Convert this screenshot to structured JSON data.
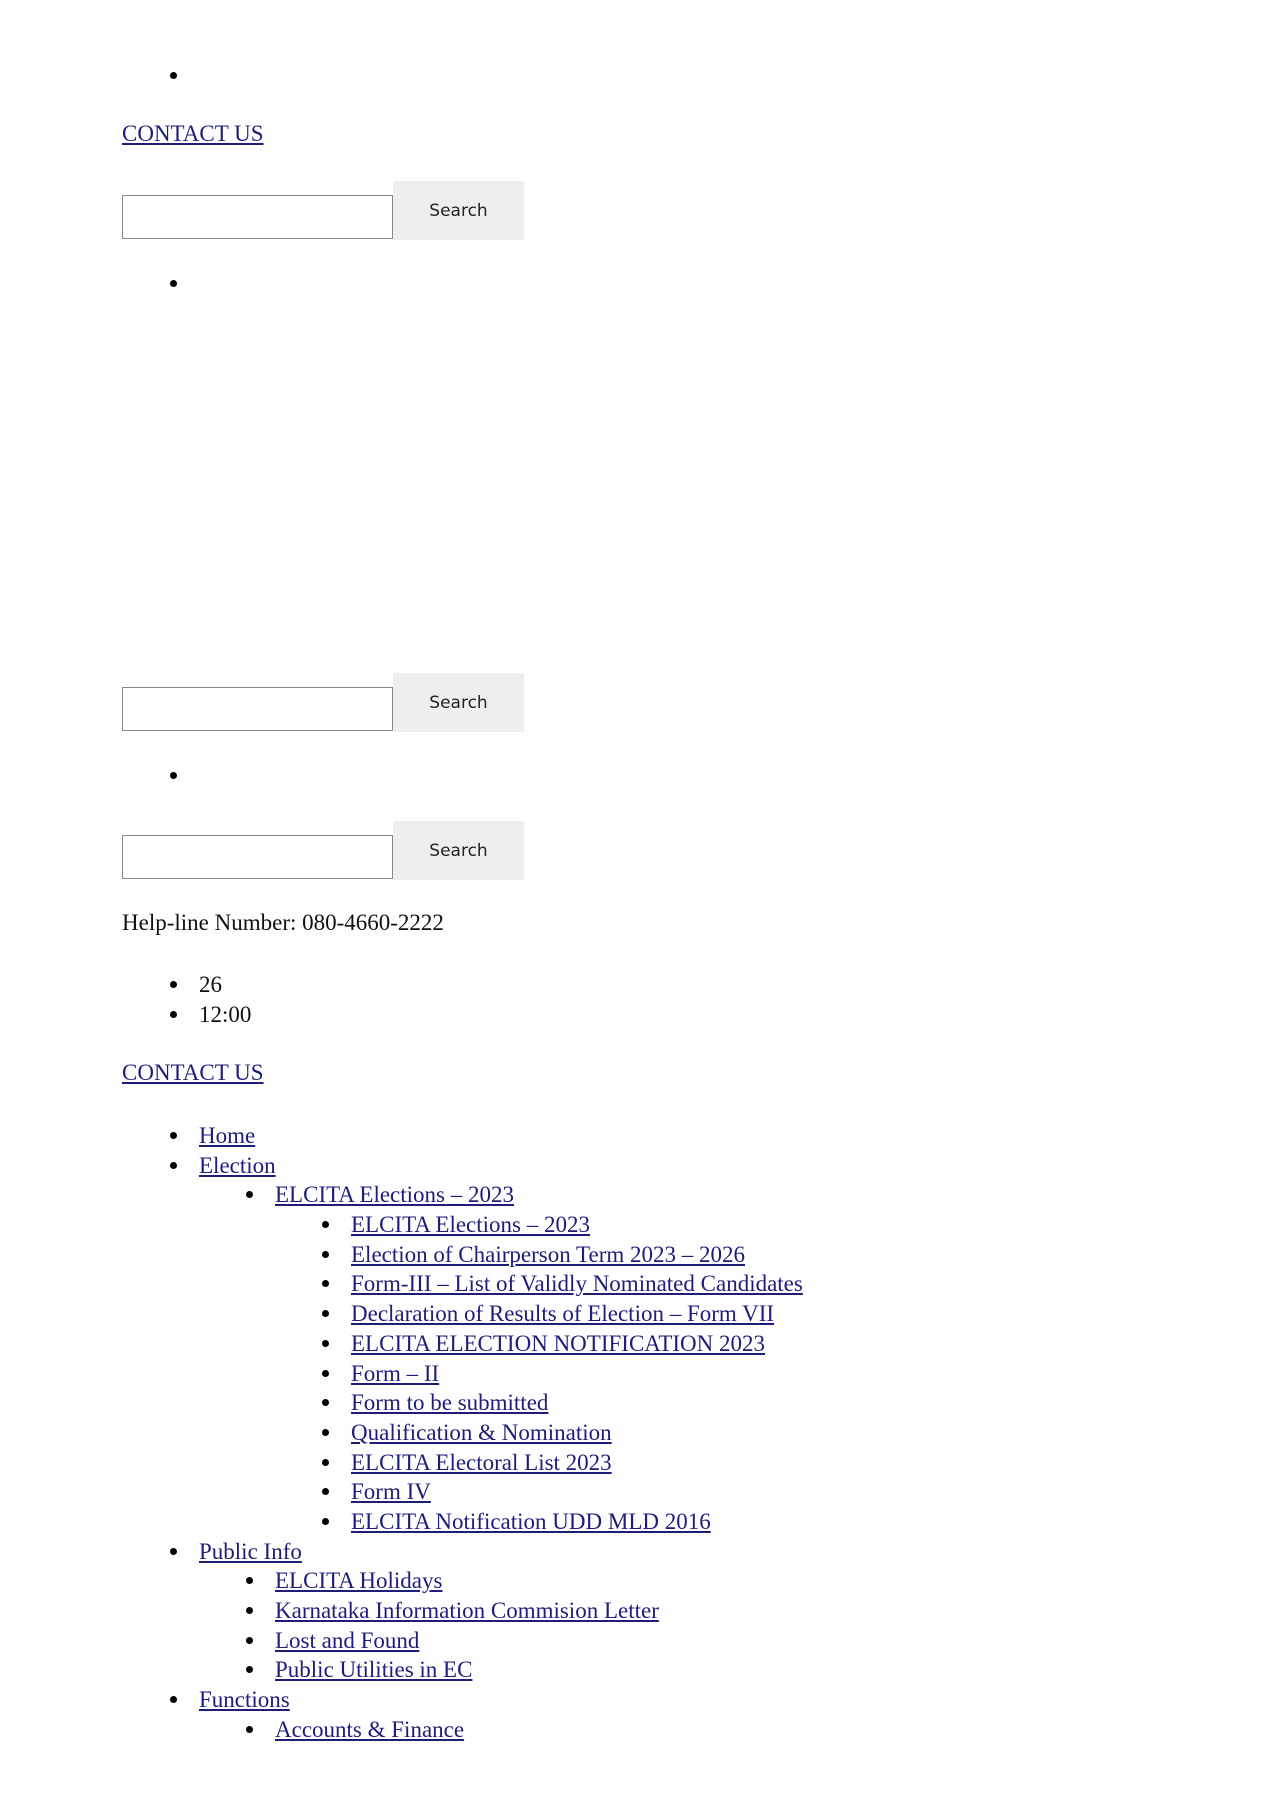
{
  "header": {
    "contact_label": "CONTACT US ",
    "search_button": "Search",
    "search_value": ""
  },
  "helpline": "Help-line Number: 080-4660-2222",
  "info_list": [
    "26",
    "12:00"
  ],
  "contact_label_2": "CONTACT US ",
  "nav": [
    {
      "label": "Home",
      "level": 1
    },
    {
      "label": "Election",
      "level": 1
    },
    {
      "label": "ELCITA Elections – 2023",
      "level": 2
    },
    {
      "label": "ELCITA Elections – 2023",
      "level": 3
    },
    {
      "label": "Election of Chairperson Term 2023 – 2026",
      "level": 3
    },
    {
      "label": "Form-III – List of Validly Nominated Candidates",
      "level": 3
    },
    {
      "label": "Declaration of Results of Election – Form VII",
      "level": 3
    },
    {
      "label": "ELCITA ELECTION NOTIFICATION 2023",
      "level": 3
    },
    {
      "label": "Form – II",
      "level": 3
    },
    {
      "label": "Form to be submitted",
      "level": 3
    },
    {
      "label": "Qualification & Nomination",
      "level": 3
    },
    {
      "label": "ELCITA Electoral List 2023",
      "level": 3
    },
    {
      "label": "Form IV",
      "level": 3
    },
    {
      "label": "ELCITA Notification UDD MLD 2016",
      "level": 3
    },
    {
      "label": "Public Info",
      "level": 1
    },
    {
      "label": "ELCITA Holidays",
      "level": 2
    },
    {
      "label": "Karnataka Information Commision Letter",
      "level": 2
    },
    {
      "label": "Lost and Found",
      "level": 2
    },
    {
      "label": "Public Utilities in EC",
      "level": 2
    },
    {
      "label": "Functions",
      "level": 1
    },
    {
      "label": "Accounts & Finance",
      "level": 2
    }
  ]
}
